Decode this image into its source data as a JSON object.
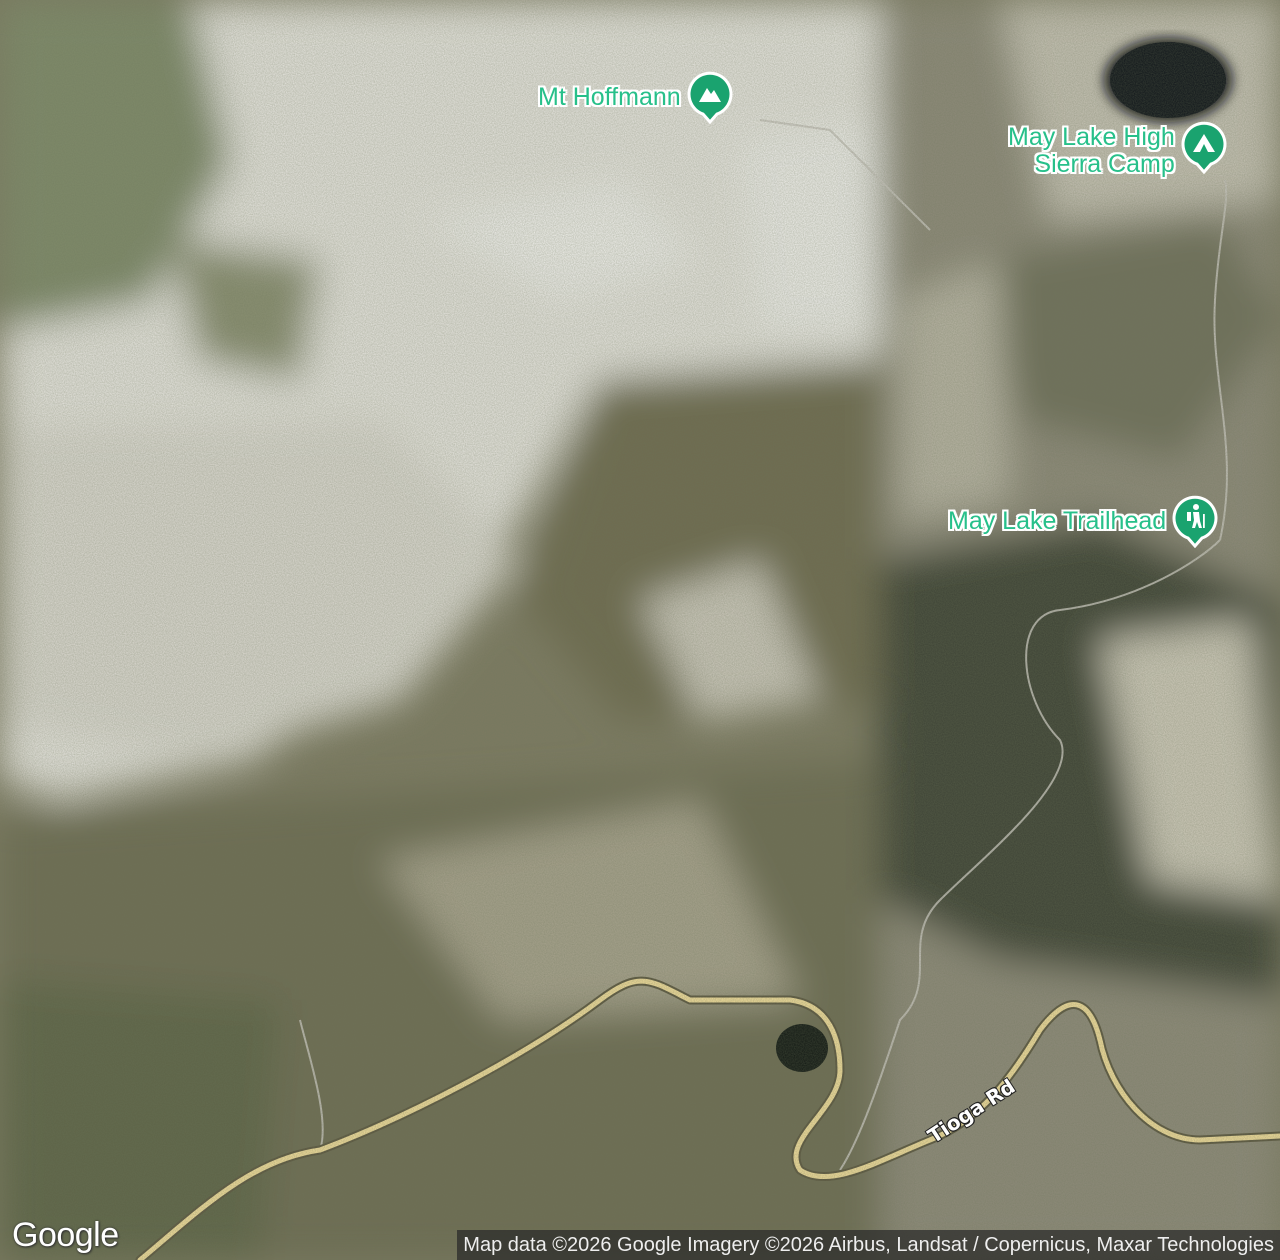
{
  "map": {
    "type": "satellite",
    "pois": [
      {
        "name": "Mt Hoffmann",
        "kind": "peak",
        "icon": "mountain-icon"
      },
      {
        "name": "May Lake High\nSierra Camp",
        "kind": "campground",
        "icon": "tent-icon"
      },
      {
        "name": "May Lake Trailhead",
        "kind": "trailhead",
        "icon": "hiker-icon"
      }
    ],
    "road_label": "Tioga Rd",
    "logo": "Google",
    "attribution": "Map data ©2026 Google Imagery ©2026 Airbus, Landsat / Copernicus, Maxar Technologies",
    "colors": {
      "poi": "#1aa36f",
      "road": "#f3de9c"
    }
  }
}
